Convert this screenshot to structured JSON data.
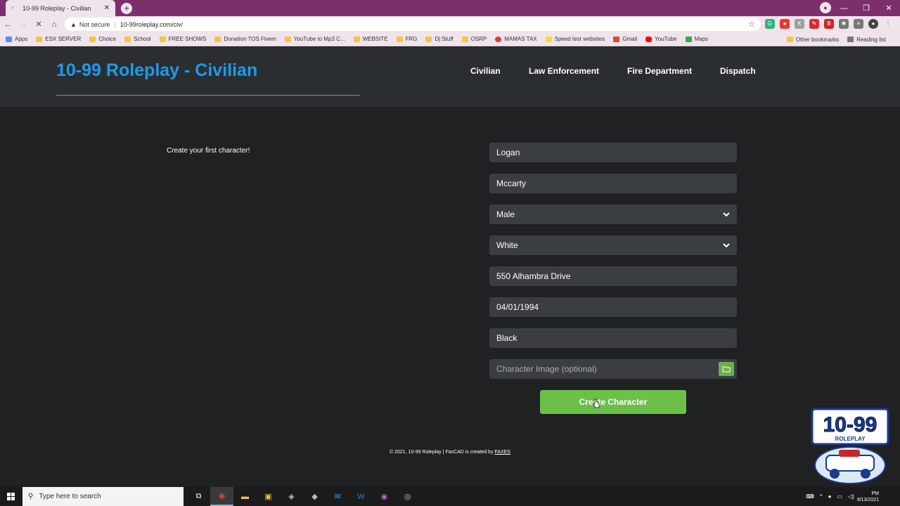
{
  "browser": {
    "tab_title": "10-99 Roleplay - Civilian",
    "tab_close": "✕",
    "new_tab": "+",
    "security_label": "Not secure",
    "url": "10-99roleplay.com/civ/",
    "bookmarks": [
      "Apps",
      "ESX SERVER",
      "Choice",
      "School",
      "FREE SHOWS",
      "Donation TOS Fivem",
      "YouTube to Mp3 C...",
      "WEBSITE",
      "FRG",
      "Dj Stuff",
      "OSRP",
      "MAMAS TAX",
      "Speed test websites",
      "Gmail",
      "YouTube",
      "Maps"
    ],
    "other_bookmarks": "Other bookmarks",
    "reading_list": "Reading list"
  },
  "site": {
    "brand": "10-99 Roleplay - Civilian",
    "nav": [
      "Civilian",
      "Law Enforcement",
      "Fire Department",
      "Dispatch"
    ],
    "intro": "Create your first character!",
    "form": {
      "first_name": "Logan",
      "last_name": "Mccarty",
      "gender": "Male",
      "race": "White",
      "address": "550 Alhambra Drive",
      "dob": "04/01/1994",
      "hair": "Black",
      "image_placeholder": "Character Image (optional)",
      "submit": "Create Character"
    },
    "footer_text": "© 2021, 10-99 Roleplay | FaxCAD is created by ",
    "footer_link": "FAXES",
    "logo_text": "10-99",
    "logo_sub": "ROLEPLAY"
  },
  "taskbar": {
    "search_placeholder": "Type here to search",
    "time": "PM",
    "date": "9/13/2021"
  },
  "colors": {
    "brand": "#1e9be8",
    "button": "#6cc04a",
    "header_bg": "#2b2e31",
    "page_bg": "#1f2123",
    "field_bg": "#3a3d41"
  }
}
